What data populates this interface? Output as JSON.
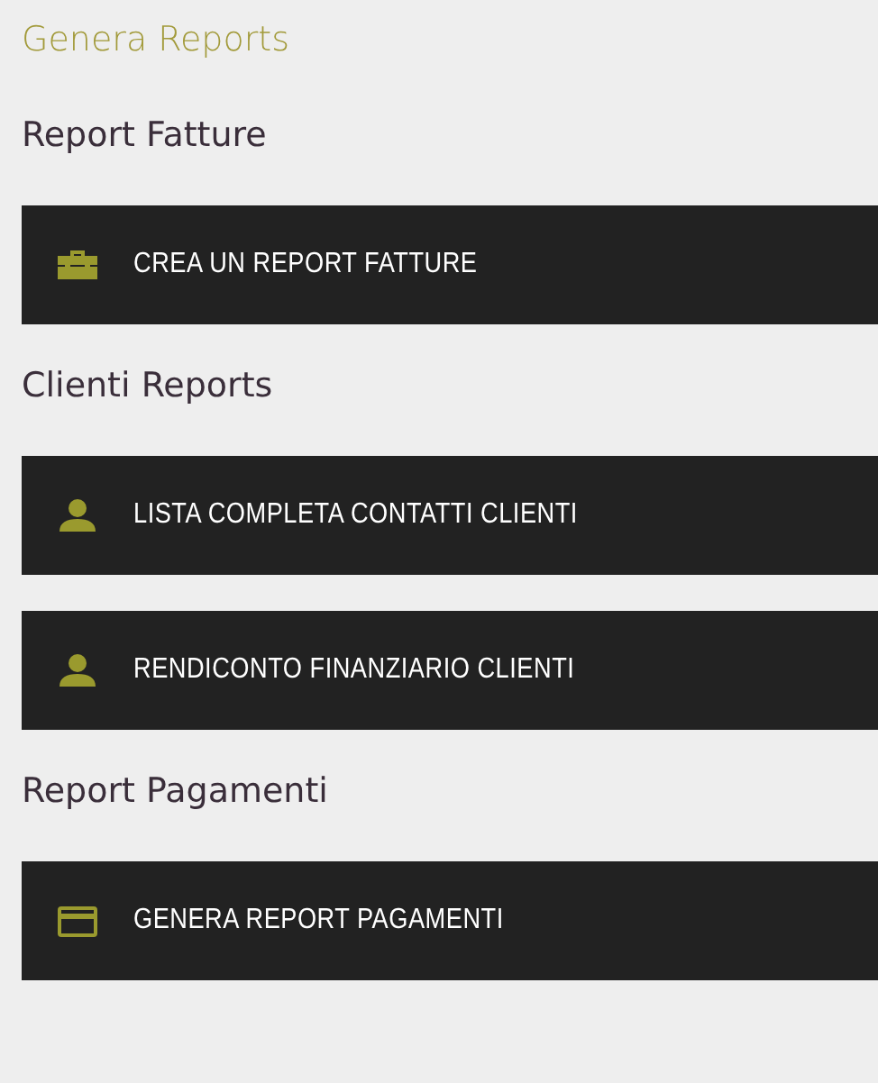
{
  "title": "Genera Reports",
  "sections": [
    {
      "heading": "Report Fatture",
      "buttons": [
        {
          "label": "CREA UN REPORT FATTURE",
          "kind": "briefcase"
        }
      ]
    },
    {
      "heading": "Clienti Reports",
      "buttons": [
        {
          "label": "LISTA COMPLETA CONTATTI CLIENTI",
          "kind": "person"
        },
        {
          "label": "RENDICONTO FINANZIARIO CLIENTI",
          "kind": "person"
        }
      ]
    },
    {
      "heading": "Report Pagamenti",
      "buttons": [
        {
          "label": "GENERA REPORT PAGAMENTI",
          "kind": "card"
        }
      ]
    }
  ]
}
